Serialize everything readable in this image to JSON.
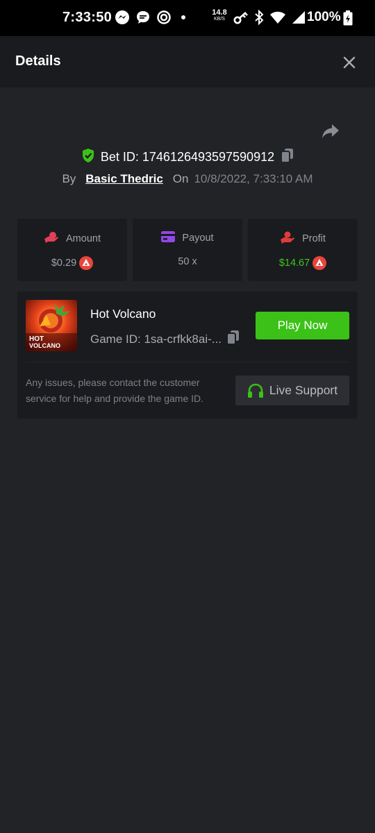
{
  "status_bar": {
    "time": "7:33:50",
    "net_speed_value": "14.8",
    "net_speed_unit": "KB/S",
    "battery": "100%"
  },
  "header": {
    "title": "Details"
  },
  "bet": {
    "id_label": "Bet ID: 1746126493597590912",
    "by_label": "By",
    "user": "Basic Thedric",
    "on_label": "On",
    "date": "10/8/2022, 7:33:10 AM"
  },
  "stats": [
    {
      "label": "Amount",
      "value": "$0.29",
      "icon": "amount-icon"
    },
    {
      "label": "Payout",
      "value": "50 x",
      "icon": "payout-icon"
    },
    {
      "label": "Profit",
      "value": "$14.67",
      "icon": "profit-icon"
    }
  ],
  "game": {
    "name": "Hot Volcano",
    "id_text": "Game ID: 1sa-crfkk8ai-...",
    "play_label": "Play Now",
    "thumb_text_1": "HOT",
    "thumb_text_2": "VOLCANO",
    "support_text": "Any issues, please contact the customer service for help and provide the game ID.",
    "support_label": "Live Support"
  },
  "colors": {
    "background": "#222326",
    "card": "#1a1b1e",
    "accent_green": "#3bc117",
    "profit_green": "#3cc625",
    "coin_red": "#e8453c"
  }
}
